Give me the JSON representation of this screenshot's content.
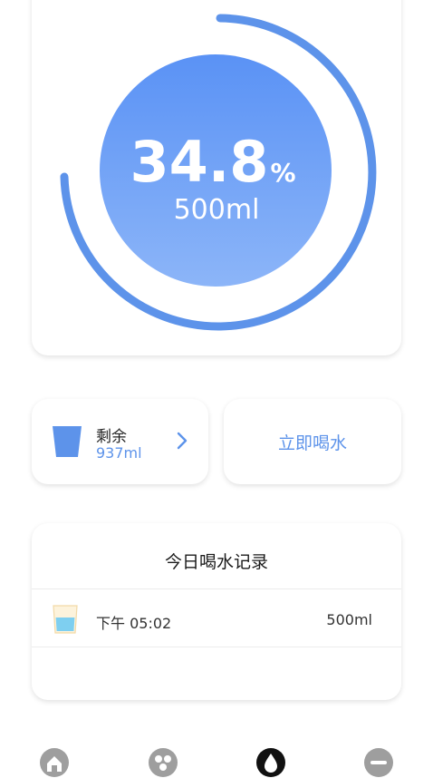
{
  "progress": {
    "percent_value": "34.8",
    "percent_sign": "%",
    "amount": "500ml",
    "fraction": 0.348
  },
  "remaining": {
    "label": "剩余",
    "value": "937ml"
  },
  "drink_now": {
    "label": "立即喝水"
  },
  "records": {
    "title": "今日喝水记录",
    "items": [
      {
        "time": "下午 05:02",
        "amount": "500ml"
      }
    ]
  },
  "nav": {
    "items": [
      "home-icon",
      "explore-icon",
      "water-drop-icon",
      "profile-icon"
    ],
    "active_index": 2
  },
  "colors": {
    "accent": "#5d93ea",
    "circle_top": "#5b93f5",
    "circle_bottom": "#8ab4f8"
  }
}
